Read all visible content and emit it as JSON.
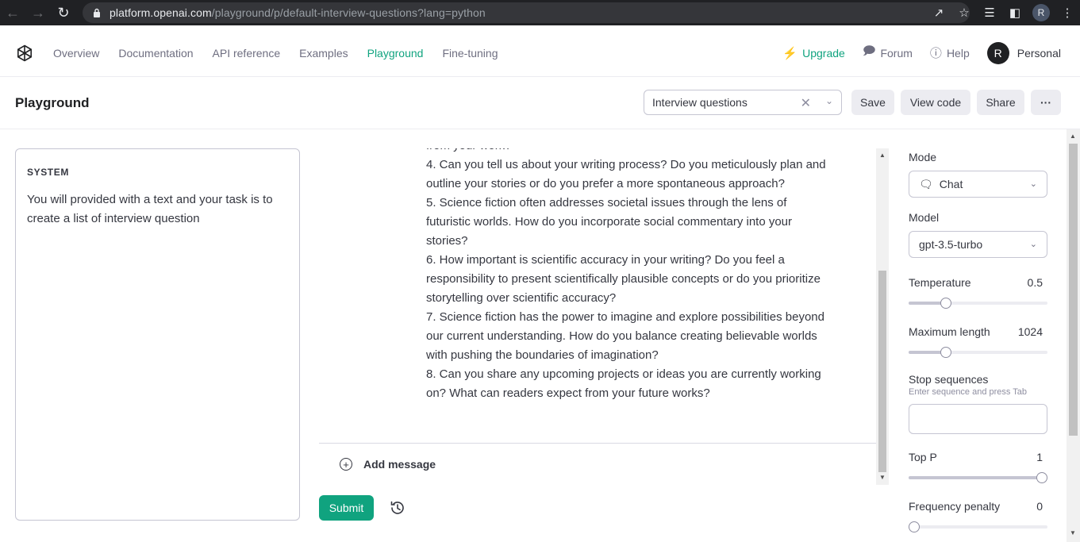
{
  "browser": {
    "url_host": "platform.openai.com",
    "url_path": "/playground/p/default-interview-questions?lang=python",
    "profile_initial": "R"
  },
  "header": {
    "nav": [
      "Overview",
      "Documentation",
      "API reference",
      "Examples",
      "Playground",
      "Fine-tuning"
    ],
    "active_nav": "Playground",
    "upgrade": "Upgrade",
    "forum": "Forum",
    "help": "Help",
    "avatar_initial": "R",
    "account": "Personal",
    "accent_color": "#10a37f"
  },
  "playground": {
    "title": "Playground",
    "preset_value": "Interview questions",
    "save": "Save",
    "view_code": "View code",
    "share": "Share",
    "more": "···"
  },
  "system": {
    "label": "SYSTEM",
    "text": "You will provided with a text and your task is to create a list of interview question"
  },
  "chat": {
    "lines": [
      "from your work?",
      "4. Can you tell us about your writing process? Do you meticulously plan and outline your stories or do you prefer a more spontaneous approach?",
      "5. Science fiction often addresses societal issues through the lens of futuristic worlds. How do you incorporate social commentary into your stories?",
      "6. How important is scientific accuracy in your writing? Do you feel a responsibility to present scientifically plausible concepts or do you prioritize storytelling over scientific accuracy?",
      "7. Science fiction has the power to imagine and explore possibilities beyond our current understanding. How do you balance creating believable worlds with pushing the boundaries of imagination?",
      "8. Can you share any upcoming projects or ideas you are currently working on? What can readers expect from your future works?"
    ],
    "add_message": "Add message",
    "submit": "Submit"
  },
  "settings": {
    "mode_label": "Mode",
    "mode_value": "Chat",
    "model_label": "Model",
    "model_value": "gpt-3.5-turbo",
    "temperature_label": "Temperature",
    "temperature_value": "0.5",
    "temperature_level": 0.25,
    "max_length_label": "Maximum length",
    "max_length_value": "1024",
    "max_length_level": 0.25,
    "stop_label": "Stop sequences",
    "stop_hint": "Enter sequence and press Tab",
    "top_p_label": "Top P",
    "top_p_value": "1",
    "top_p_level": 1.0,
    "freq_label": "Frequency penalty",
    "freq_value": "0",
    "freq_level": 0.0
  }
}
